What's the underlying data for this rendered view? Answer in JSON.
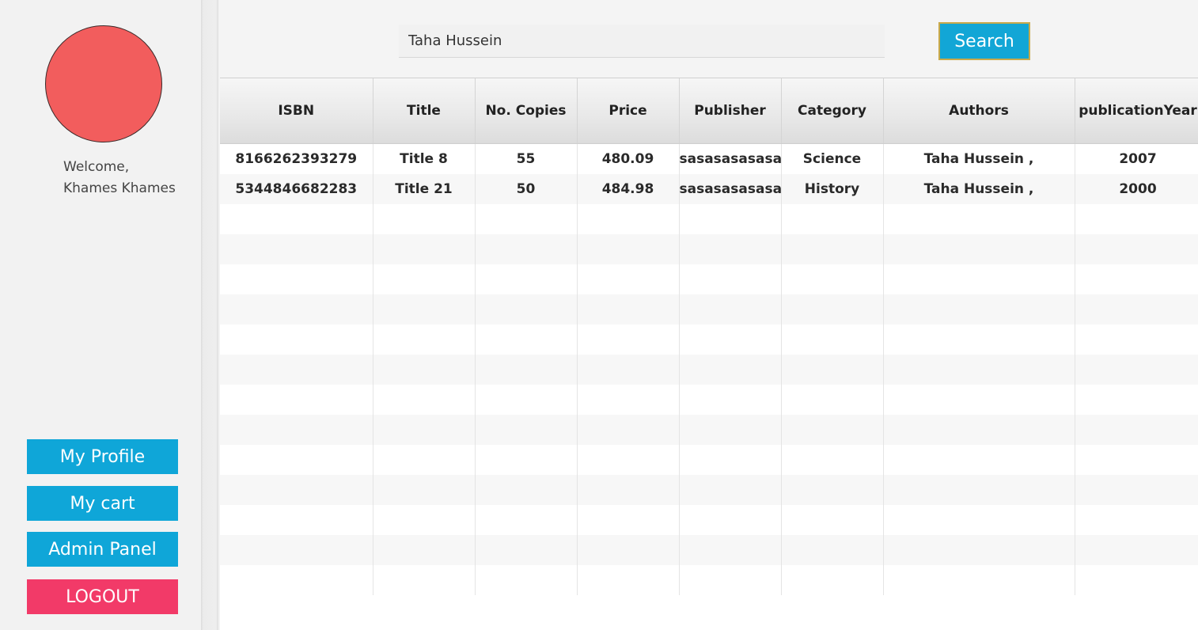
{
  "sidebar": {
    "welcome_line1": "Welcome,",
    "welcome_line2": "Khames Khames",
    "buttons": {
      "profile": "My Profile",
      "cart": "My cart",
      "admin": "Admin Panel",
      "logout": "LOGOUT"
    },
    "avatar_color": "#f25d5d"
  },
  "search": {
    "value": "Taha Hussein",
    "button_label": "Search"
  },
  "table": {
    "columns": [
      "ISBN",
      "Title",
      "No. Copies",
      "Price",
      "Publisher",
      "Category",
      "Authors",
      "publicationYear"
    ],
    "rows": [
      [
        "8166262393279",
        "Title 8",
        "55",
        "480.09",
        "sasasasasasa",
        "Science",
        "Taha Hussein ,",
        "2007"
      ],
      [
        "5344846682283",
        "Title 21",
        "50",
        "484.98",
        "sasasasasasa",
        "History",
        "Taha Hussein ,",
        "2000"
      ]
    ]
  },
  "colors": {
    "accent": "#0fa6d8",
    "logout": "#f23a68"
  }
}
